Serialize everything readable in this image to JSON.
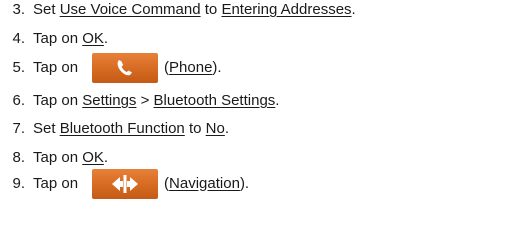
{
  "steps": [
    {
      "number": "3.",
      "parts": [
        "Set ",
        "Use Voice Command",
        " to ",
        "Entering Addresses",
        "."
      ]
    },
    {
      "number": "4.",
      "parts": [
        "Tap on ",
        "OK",
        "."
      ]
    },
    {
      "number": "5.",
      "before": "Tap on",
      "icon": "phone-icon",
      "open": "(",
      "link": "Phone",
      "close": ")."
    },
    {
      "number": "6.",
      "parts": [
        "Tap on ",
        "Settings",
        " > ",
        "Bluetooth Settings",
        "."
      ]
    },
    {
      "number": "7.",
      "parts": [
        "Set ",
        "Bluetooth Function",
        " to ",
        "No",
        "."
      ]
    },
    {
      "number": "8.",
      "parts": [
        "Tap on ",
        "OK",
        "."
      ]
    },
    {
      "number": "9.",
      "before": "Tap on",
      "icon": "navigation-icon",
      "open": "(",
      "link": "Navigation",
      "close": ")."
    }
  ],
  "colors": {
    "button_orange": "#d66a22",
    "icon_white": "#ffffff",
    "text": "#1a1a1a"
  }
}
